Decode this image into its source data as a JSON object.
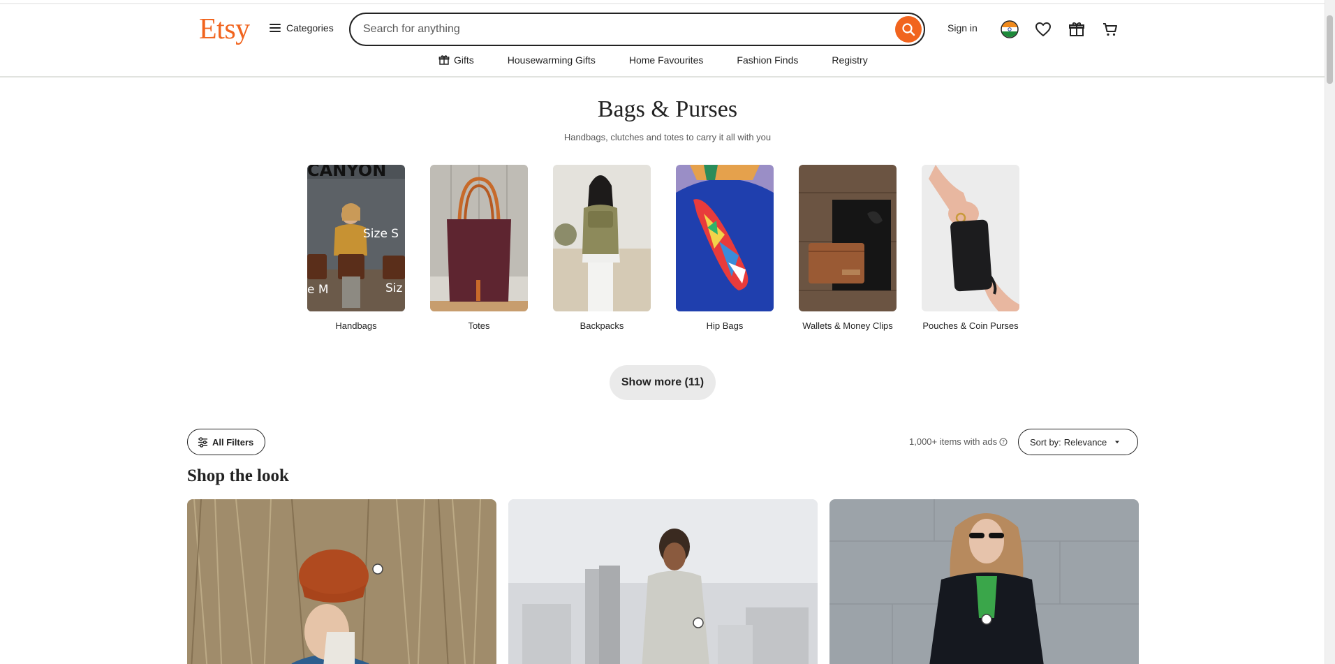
{
  "header": {
    "logo": "Etsy",
    "categories_label": "Categories",
    "search_placeholder": "Search for anything",
    "signin_label": "Sign in",
    "icons": [
      "india-flag-icon",
      "heart-icon",
      "gift-icon",
      "cart-icon"
    ]
  },
  "subnav": {
    "items": [
      {
        "label": "Gifts",
        "icon": "gift-icon"
      },
      {
        "label": "Housewarming Gifts"
      },
      {
        "label": "Home Favourites"
      },
      {
        "label": "Fashion Finds"
      },
      {
        "label": "Registry"
      }
    ]
  },
  "page": {
    "title": "Bags & Purses",
    "subtitle": "Handbags, clutches and totes to carry it all with you"
  },
  "categories": [
    {
      "label": "Handbags"
    },
    {
      "label": "Totes"
    },
    {
      "label": "Backpacks"
    },
    {
      "label": "Hip Bags"
    },
    {
      "label": "Wallets & Money Clips"
    },
    {
      "label": "Pouches & Coin Purses"
    }
  ],
  "handbag_image_text": {
    "top": "CANYON",
    "right": "Size S",
    "bottom_left": "e M",
    "bottom_right": "Siz"
  },
  "show_more_label": "Show more (11)",
  "toolbar": {
    "filters_label": "All Filters",
    "count_label": "1,000+ items with ads",
    "sort_prefix": "Sort by:",
    "sort_value": "Relevance"
  },
  "section": {
    "title": "Shop the look"
  },
  "colors": {
    "brand": "#f1641e",
    "text": "#222222",
    "muted": "#595959"
  }
}
